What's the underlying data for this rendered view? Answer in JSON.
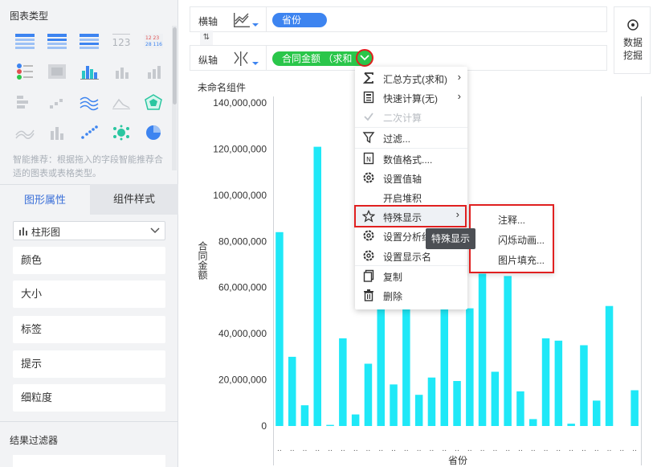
{
  "left_panel": {
    "chart_types_title": "图表类型",
    "recommend_text": "智能推荐：根据拖入的字段智能推荐合适的图表或表格类型。",
    "tabs": {
      "graph_props": "图形属性",
      "component_style": "组件样式"
    },
    "chart_select": {
      "value": "柱形图"
    },
    "props": [
      "颜色",
      "大小",
      "标签",
      "提示",
      "细粒度"
    ],
    "filter_title": "结果过滤器"
  },
  "axes": {
    "x": {
      "label": "横轴",
      "field": "省份"
    },
    "y": {
      "label": "纵轴",
      "field": "合同金额 （求和"
    }
  },
  "mining": {
    "line1": "数据",
    "line2": "挖掘"
  },
  "chart_panel": {
    "title": "未命名组件"
  },
  "context_menu": {
    "items": [
      {
        "label": "汇总方式(求和)",
        "icon": "sigma-icon",
        "arrow": true
      },
      {
        "label": "快速计算(无)",
        "icon": "calculator-icon",
        "arrow": true
      },
      {
        "label": "二次计算",
        "icon": "check-icon",
        "disabled": true
      },
      {
        "label": "过滤...",
        "icon": "filter-icon"
      },
      {
        "label": "数值格式....",
        "icon": "number-format-icon"
      },
      {
        "label": "设置值轴",
        "icon": "gear-icon"
      },
      {
        "label": "开启堆积",
        "icon": ""
      },
      {
        "label": "特殊显示",
        "icon": "star-icon",
        "arrow": true
      },
      {
        "label": "设置分析线",
        "icon": "gear-icon"
      },
      {
        "label": "设置显示名",
        "icon": "gear-icon"
      },
      {
        "label": "复制",
        "icon": "copy-icon"
      },
      {
        "label": "删除",
        "icon": "trash-icon"
      }
    ],
    "submenu": [
      "注释...",
      "闪烁动画...",
      "图片填充..."
    ],
    "tooltip": "特殊显示"
  },
  "chart_data": {
    "type": "bar",
    "xlabel": "省份",
    "ylabel": "合同金额",
    "ylim": [
      0,
      140000000
    ],
    "yticks": [
      "0",
      "20,000,000",
      "40,000,000",
      "60,000,000",
      "80,000,000",
      "100,000,000",
      "120,000,000",
      "140,000,000"
    ],
    "grid": false,
    "bar_color": "#1fe8f7",
    "values": [
      84000000,
      30000000,
      9000000,
      121000000,
      500000,
      38000000,
      5000000,
      27000000,
      57000000,
      18000000,
      53000000,
      13500000,
      21000000,
      51000000,
      19500000,
      51000000,
      66000000,
      23500000,
      65000000,
      15000000,
      3000000,
      38000000,
      37000000,
      1000000,
      35000000,
      11000000,
      52000000,
      0,
      15500000
    ]
  }
}
